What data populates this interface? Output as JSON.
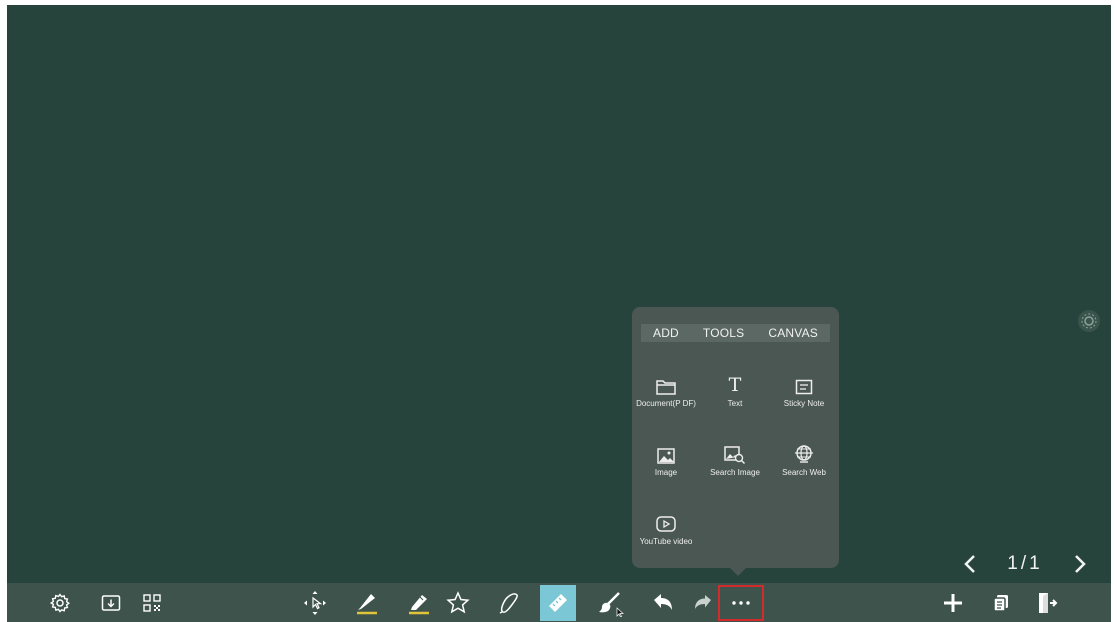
{
  "popup": {
    "tabs": [
      "ADD",
      "TOOLS",
      "CANVAS"
    ],
    "items": {
      "document": "Document(P DF)",
      "text": "Text",
      "sticky": "Sticky Note",
      "image": "Image",
      "search_image": "Search Image",
      "search_web": "Search Web",
      "youtube": "YouTube video"
    }
  },
  "pager": {
    "label": "1/1"
  },
  "icons": [
    "gear-icon",
    "folder-download-icon",
    "qr-code-icon",
    "move-select-icon",
    "pen-icon",
    "highlighter-icon",
    "star-shape-icon",
    "lasso-icon",
    "ruler-icon",
    "brush-eraser-icon",
    "undo-icon",
    "redo-icon",
    "more-icon",
    "add-page-icon",
    "pages-icon",
    "exit-icon"
  ],
  "colors": {
    "canvas": "#27443c",
    "toolbar": "#3e534c",
    "popup": "#4b5753",
    "active_tool": "#7cc7d6",
    "highlight_border": "#d32b2b",
    "pen_underline": "#e0c43a"
  }
}
